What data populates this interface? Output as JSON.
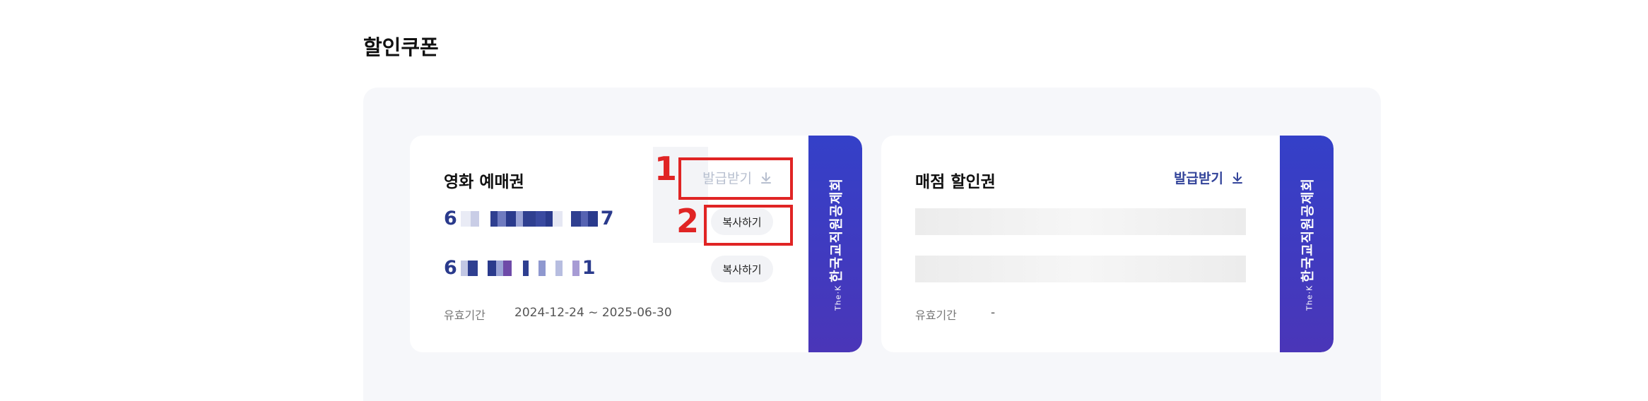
{
  "section": {
    "title": "할인쿠폰"
  },
  "cards": {
    "movie": {
      "title": "영화 예매권",
      "issue_label": "발급받기",
      "code1_start": "6",
      "code1_end": "7",
      "code2_start": "6",
      "code2_end": "1",
      "copy1_label": "복사하기",
      "copy2_label": "복사하기",
      "validity_label": "유효기간",
      "validity_value": "2024-12-24 ~ 2025-06-30",
      "stub_the": "The·K",
      "stub_text": "한국교직원공제회"
    },
    "store": {
      "title": "매점 할인권",
      "issue_label": "발급받기",
      "validity_label": "유효기간",
      "validity_value": "-",
      "stub_the": "The·K",
      "stub_text": "한국교직원공제회"
    }
  },
  "annotations": {
    "marker1": "1",
    "marker2": "2",
    "color": "#e02424"
  },
  "colors": {
    "accent": "#33449a",
    "code": "#2a3a8c",
    "stub": "#3a3cc4"
  }
}
